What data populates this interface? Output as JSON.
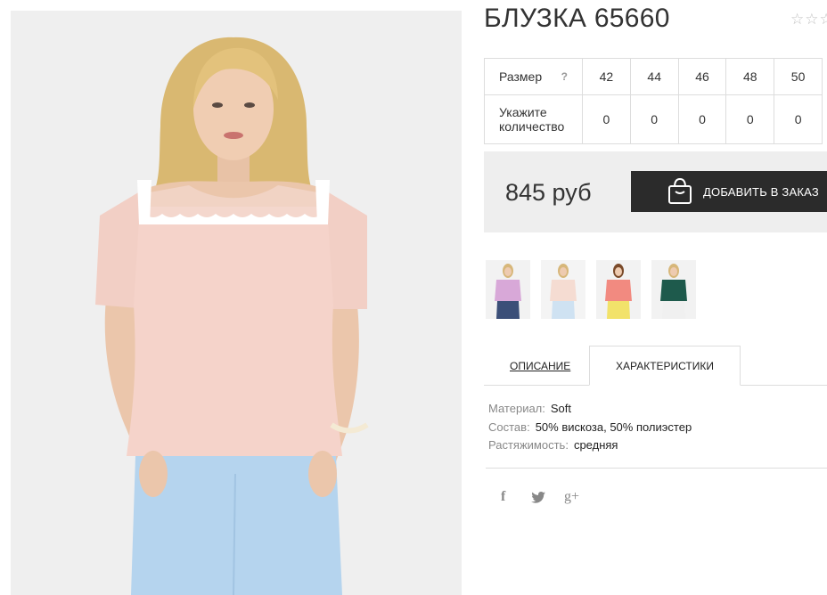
{
  "product": {
    "title": "БЛУЗКА 65660",
    "rating_stars": "☆☆☆"
  },
  "sizes": {
    "label": "Размер",
    "help": "?",
    "values": [
      "42",
      "44",
      "46",
      "48",
      "50"
    ],
    "qty_label_line1": "Укажите",
    "qty_label_line2": "количество",
    "quantities": [
      "0",
      "0",
      "0",
      "0",
      "0"
    ]
  },
  "purchase": {
    "price": "845 руб",
    "add_button": "ДОБАВИТЬ В ЗАКАЗ",
    "button_icon": "shopping-bag-icon"
  },
  "thumbnails": {
    "variants": [
      "lilac",
      "peach",
      "coral",
      "green"
    ],
    "colors": [
      "#d8a8d8",
      "#f5dcd2",
      "#f28a80",
      "#1e5a4c"
    ]
  },
  "tabs": {
    "description": "ОПИСАНИЕ",
    "characteristics": "ХАРАКТЕРИСТИКИ"
  },
  "specs": [
    {
      "key": "Материал:",
      "value": "Soft"
    },
    {
      "key": "Состав:",
      "value": "50% вискоза, 50% полиэстер"
    },
    {
      "key": "Растяжимость:",
      "value": "средняя"
    }
  ],
  "social": {
    "facebook": "f",
    "twitter_icon": "twitter-bird-icon",
    "google_plus": "g+"
  },
  "colors": {
    "button_bg": "#2b2b2b",
    "price_box_bg": "#eeeeee",
    "border": "#dddddd",
    "blouse": "#f5d3ca",
    "trousers": "#b5d4ee"
  }
}
